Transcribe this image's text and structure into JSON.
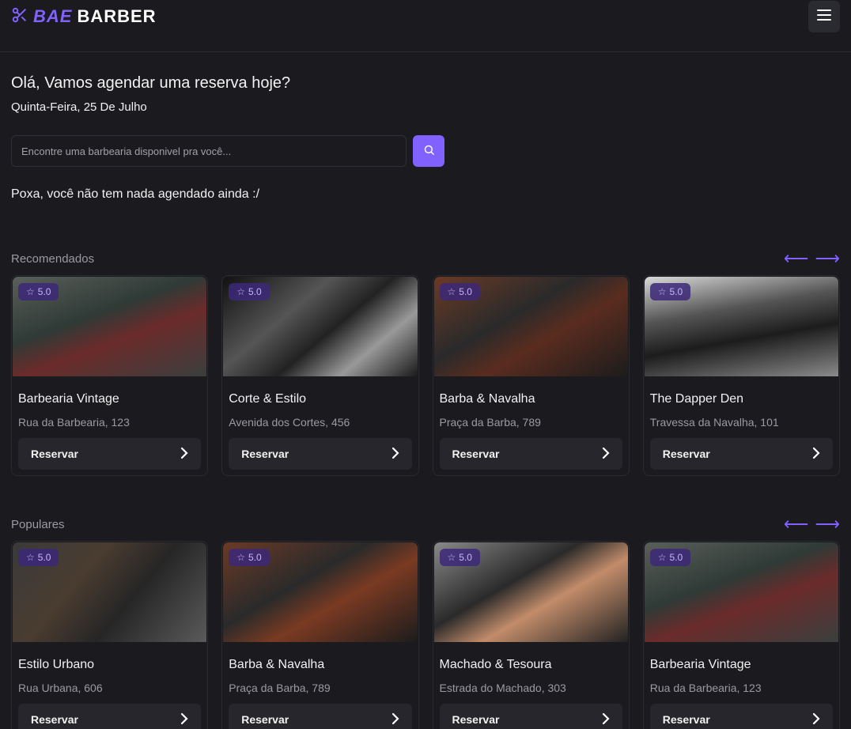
{
  "header": {
    "logo_part1": "BAE",
    "logo_part2": "BARBER",
    "accent_color": "#8161ff",
    "menu_icon": "hamburger-icon"
  },
  "greeting": {
    "title": "Olá, Vamos agendar uma reserva hoje?",
    "date": "Quinta-Feira, 25 De Julho"
  },
  "search": {
    "placeholder": "Encontre uma barbearia disponivel pra você...",
    "button_icon": "search-icon"
  },
  "bookings": {
    "empty_message": "Poxa, você não tem nada agendado ainda :/"
  },
  "sections": {
    "recommended": {
      "title": "Recomendados",
      "cards": [
        {
          "rating": "5.0",
          "name": "Barbearia Vintage",
          "address": "Rua da Barbearia, 123",
          "button": "Reservar"
        },
        {
          "rating": "5.0",
          "name": "Corte & Estilo",
          "address": "Avenida dos Cortes, 456",
          "button": "Reservar"
        },
        {
          "rating": "5.0",
          "name": "Barba & Navalha",
          "address": "Praça da Barba, 789",
          "button": "Reservar"
        },
        {
          "rating": "5.0",
          "name": "The Dapper Den",
          "address": "Travessa da Navalha, 101",
          "button": "Reservar"
        }
      ]
    },
    "popular": {
      "title": "Populares",
      "cards": [
        {
          "rating": "5.0",
          "name": "Estilo Urbano",
          "address": "Rua Urbana, 606",
          "button": "Reservar"
        },
        {
          "rating": "5.0",
          "name": "Barba & Navalha",
          "address": "Praça da Barba, 789",
          "button": "Reservar"
        },
        {
          "rating": "5.0",
          "name": "Machado & Tesoura",
          "address": "Estrada do Machado, 303",
          "button": "Reservar"
        },
        {
          "rating": "5.0",
          "name": "Barbearia Vintage",
          "address": "Rua da Barbearia, 123",
          "button": "Reservar"
        }
      ]
    }
  }
}
